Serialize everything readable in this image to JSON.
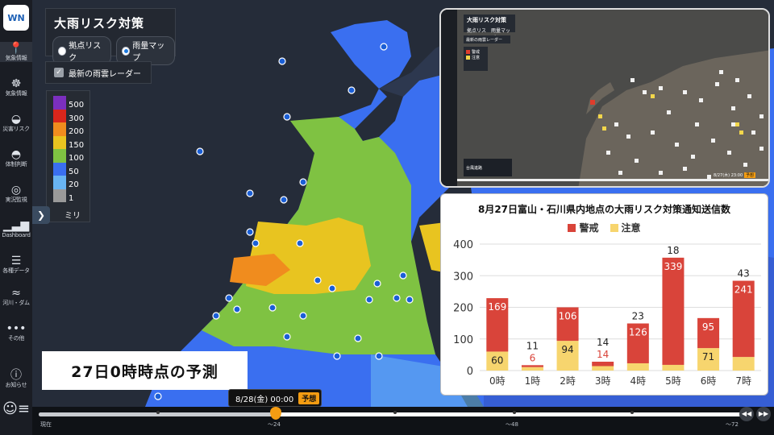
{
  "app": {
    "logo_text": "WN"
  },
  "sidebar": {
    "items": [
      {
        "label": "気象情報",
        "icon": "map-pin-icon"
      },
      {
        "label": "気象情報",
        "icon": "person-walking-icon"
      },
      {
        "label": "災害リスク",
        "icon": "gauge-icon"
      },
      {
        "label": "体制判断",
        "icon": "speedometer-icon"
      },
      {
        "label": "実況監視",
        "icon": "target-icon"
      },
      {
        "label": "Dashboard",
        "icon": "bar-chart-icon"
      },
      {
        "label": "各種データ",
        "icon": "database-icon"
      },
      {
        "label": "河川・ダム",
        "icon": "wave-icon"
      },
      {
        "label": "その他",
        "icon": "more-icon"
      },
      {
        "label": "お知らせ",
        "icon": "info-icon"
      }
    ]
  },
  "panel": {
    "title": "大雨リスク対策",
    "radio_options": [
      "拠点リスク",
      "雨量マップ"
    ],
    "selected_option": "雨量マップ",
    "radar_label": "最新の雨雲レーダー"
  },
  "legend": {
    "levels": [
      {
        "label": "500",
        "color": "#7b2fbf"
      },
      {
        "label": "300",
        "color": "#d9261c"
      },
      {
        "label": "200",
        "color": "#f08c1e"
      },
      {
        "label": "150",
        "color": "#e8c420"
      },
      {
        "label": "100",
        "color": "#7fc242"
      },
      {
        "label": "50",
        "color": "#3a6ff0"
      },
      {
        "label": "20",
        "color": "#68b4f2"
      },
      {
        "label": "1",
        "color": "#9a9a9a"
      }
    ],
    "unit": "ミリ"
  },
  "caption": "27日0時時点の予測",
  "timeline": {
    "current_time": "8/28(金) 00:00",
    "badge": "予想",
    "labels": [
      "現在",
      "〜24",
      "〜48",
      "〜72"
    ]
  },
  "inset": {
    "title": "大雨リスク対策",
    "radio_options": [
      "拠点リスク",
      "雨量マップ"
    ],
    "radar_label": "最新の雨雲レーダー",
    "legend": [
      "警戒",
      "注意"
    ],
    "timestamp": "8/27(木) 23:00",
    "badge": "予想",
    "popup_label": "台風進路"
  },
  "chart_data": {
    "type": "bar",
    "title": "8月27日富山・石川県内地点の大雨リスク対策通知送信数",
    "categories": [
      "0時",
      "1時",
      "2時",
      "3時",
      "4時",
      "5時",
      "6時",
      "7時"
    ],
    "series": [
      {
        "name": "警戒",
        "color": "#d9443a",
        "values": [
          169,
          6,
          106,
          14,
          126,
          339,
          95,
          241
        ]
      },
      {
        "name": "注意",
        "color": "#f7d56e",
        "values": [
          60,
          11,
          94,
          14,
          23,
          18,
          71,
          43
        ]
      }
    ],
    "stacked": true,
    "ylim": [
      0,
      400
    ],
    "yticks": [
      0,
      100,
      200,
      300,
      400
    ],
    "grid": true,
    "legend_position": "top"
  }
}
